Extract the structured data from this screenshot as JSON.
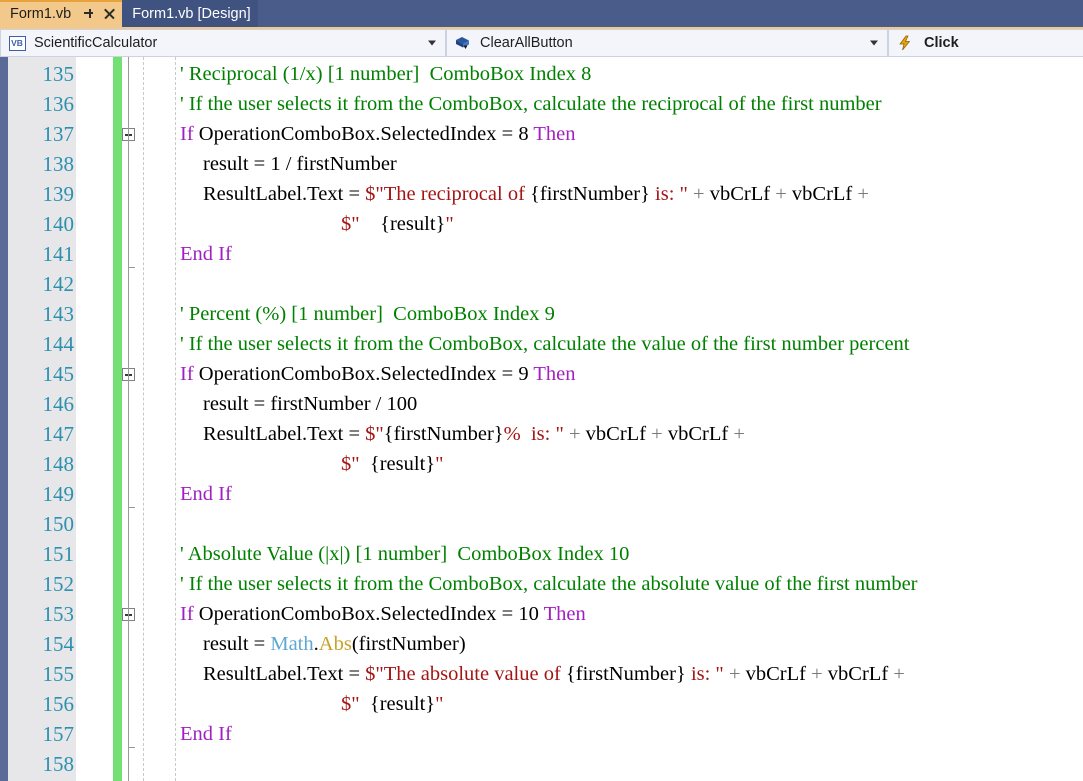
{
  "window": {
    "tabs": [
      {
        "label": "Form1.vb",
        "active": true,
        "pin_icon": "pin-icon",
        "close_icon": "close-icon"
      },
      {
        "label": "Form1.vb [Design]",
        "active": false
      }
    ]
  },
  "navbar": {
    "project_dropdown": {
      "icon": "vb-project-icon",
      "icon_text": "VB",
      "value": "ScientificCalculator",
      "arrow_icon": "chevron-down-icon"
    },
    "member_dropdown": {
      "icon": "object-member-icon",
      "value": "ClearAllButton",
      "arrow_icon": "chevron-down-icon"
    },
    "event_dropdown": {
      "icon": "lightning-event-icon",
      "value": "Click"
    }
  },
  "editor": {
    "first_line_number": 135,
    "change_bar_color": "#72e072",
    "line_number_color": "#2b91af",
    "colors": {
      "comment": "#008000",
      "keyword": "#a020c0",
      "string": "#a31515",
      "operator": "#7a7a7a",
      "type": "#5fa8d3",
      "method": "#c9a227",
      "plain": "#000000"
    },
    "lines": [
      {
        "number": 135,
        "collapse": false,
        "indent": 0,
        "tokens": [
          {
            "t": "' Reciprocal (1/x) [1 number]  ComboBox Index 8",
            "c": "comment"
          }
        ]
      },
      {
        "number": 136,
        "collapse": false,
        "indent": 0,
        "tokens": [
          {
            "t": "' If the user selects it from the ComboBox, calculate the reciprocal of the first number",
            "c": "comment"
          }
        ]
      },
      {
        "number": 137,
        "collapse": true,
        "indent": 0,
        "tokens": [
          {
            "t": "If ",
            "c": "keyword"
          },
          {
            "t": "OperationComboBox.SelectedIndex = 8 ",
            "c": "plain"
          },
          {
            "t": "Then",
            "c": "keyword"
          }
        ]
      },
      {
        "number": 138,
        "collapse": false,
        "indent": 1,
        "tokens": [
          {
            "t": "result = 1 / firstNumber",
            "c": "plain"
          }
        ]
      },
      {
        "number": 139,
        "collapse": false,
        "indent": 1,
        "tokens": [
          {
            "t": "ResultLabel.Text = ",
            "c": "plain"
          },
          {
            "t": "$\"The reciprocal of ",
            "c": "string"
          },
          {
            "t": "{firstNumber}",
            "c": "plain"
          },
          {
            "t": " is: \" ",
            "c": "string"
          },
          {
            "t": "+",
            "c": "operator"
          },
          {
            "t": " vbCrLf ",
            "c": "plain"
          },
          {
            "t": "+",
            "c": "operator"
          },
          {
            "t": " vbCrLf ",
            "c": "plain"
          },
          {
            "t": "+",
            "c": "operator"
          }
        ]
      },
      {
        "number": 140,
        "collapse": false,
        "indent": 7,
        "tokens": [
          {
            "t": "$\"",
            "c": "string"
          },
          {
            "t": "    {result}",
            "c": "plain"
          },
          {
            "t": "\"",
            "c": "string"
          }
        ]
      },
      {
        "number": 141,
        "collapse": false,
        "indent": 0,
        "tokens": [
          {
            "t": "End If",
            "c": "keyword"
          }
        ]
      },
      {
        "number": 142,
        "collapse": false,
        "indent": 0,
        "tokens": []
      },
      {
        "number": 143,
        "collapse": false,
        "indent": 0,
        "tokens": [
          {
            "t": "' Percent (%) [1 number]  ComboBox Index 9",
            "c": "comment"
          }
        ]
      },
      {
        "number": 144,
        "collapse": false,
        "indent": 0,
        "tokens": [
          {
            "t": "' If the user selects it from the ComboBox, calculate the value of the first number percent",
            "c": "comment"
          }
        ]
      },
      {
        "number": 145,
        "collapse": true,
        "indent": 0,
        "tokens": [
          {
            "t": "If ",
            "c": "keyword"
          },
          {
            "t": "OperationComboBox.SelectedIndex = 9 ",
            "c": "plain"
          },
          {
            "t": "Then",
            "c": "keyword"
          }
        ]
      },
      {
        "number": 146,
        "collapse": false,
        "indent": 1,
        "tokens": [
          {
            "t": "result = firstNumber / 100",
            "c": "plain"
          }
        ]
      },
      {
        "number": 147,
        "collapse": false,
        "indent": 1,
        "tokens": [
          {
            "t": "ResultLabel.Text = ",
            "c": "plain"
          },
          {
            "t": "$\"",
            "c": "string"
          },
          {
            "t": "{firstNumber}",
            "c": "plain"
          },
          {
            "t": "%  is: \" ",
            "c": "string"
          },
          {
            "t": "+",
            "c": "operator"
          },
          {
            "t": " vbCrLf ",
            "c": "plain"
          },
          {
            "t": "+",
            "c": "operator"
          },
          {
            "t": " vbCrLf ",
            "c": "plain"
          },
          {
            "t": "+",
            "c": "operator"
          }
        ]
      },
      {
        "number": 148,
        "collapse": false,
        "indent": 7,
        "tokens": [
          {
            "t": "$\"",
            "c": "string"
          },
          {
            "t": "  {result}",
            "c": "plain"
          },
          {
            "t": "\"",
            "c": "string"
          }
        ]
      },
      {
        "number": 149,
        "collapse": false,
        "indent": 0,
        "tokens": [
          {
            "t": "End If",
            "c": "keyword"
          }
        ]
      },
      {
        "number": 150,
        "collapse": false,
        "indent": 0,
        "tokens": []
      },
      {
        "number": 151,
        "collapse": false,
        "indent": 0,
        "tokens": [
          {
            "t": "' Absolute Value (|x|) [1 number]  ComboBox Index 10",
            "c": "comment"
          }
        ]
      },
      {
        "number": 152,
        "collapse": false,
        "indent": 0,
        "tokens": [
          {
            "t": "' If the user selects it from the ComboBox, calculate the absolute value of the first number",
            "c": "comment"
          }
        ]
      },
      {
        "number": 153,
        "collapse": true,
        "indent": 0,
        "tokens": [
          {
            "t": "If ",
            "c": "keyword"
          },
          {
            "t": "OperationComboBox.SelectedIndex = 10 ",
            "c": "plain"
          },
          {
            "t": "Then",
            "c": "keyword"
          }
        ]
      },
      {
        "number": 154,
        "collapse": false,
        "indent": 1,
        "tokens": [
          {
            "t": "result = ",
            "c": "plain"
          },
          {
            "t": "Math",
            "c": "type"
          },
          {
            "t": ".",
            "c": "plain"
          },
          {
            "t": "Abs",
            "c": "method"
          },
          {
            "t": "(firstNumber)",
            "c": "plain"
          }
        ]
      },
      {
        "number": 155,
        "collapse": false,
        "indent": 1,
        "tokens": [
          {
            "t": "ResultLabel.Text = ",
            "c": "plain"
          },
          {
            "t": "$\"The absolute value of ",
            "c": "string"
          },
          {
            "t": "{firstNumber}",
            "c": "plain"
          },
          {
            "t": " is: \" ",
            "c": "string"
          },
          {
            "t": "+",
            "c": "operator"
          },
          {
            "t": " vbCrLf ",
            "c": "plain"
          },
          {
            "t": "+",
            "c": "operator"
          },
          {
            "t": " vbCrLf ",
            "c": "plain"
          },
          {
            "t": "+",
            "c": "operator"
          }
        ]
      },
      {
        "number": 156,
        "collapse": false,
        "indent": 7,
        "tokens": [
          {
            "t": "$\"",
            "c": "string"
          },
          {
            "t": "  {result}",
            "c": "plain"
          },
          {
            "t": "\"",
            "c": "string"
          }
        ]
      },
      {
        "number": 157,
        "collapse": false,
        "indent": 0,
        "tokens": [
          {
            "t": "End If",
            "c": "keyword"
          }
        ]
      },
      {
        "number": 158,
        "collapse": false,
        "indent": 0,
        "tokens": []
      }
    ]
  }
}
